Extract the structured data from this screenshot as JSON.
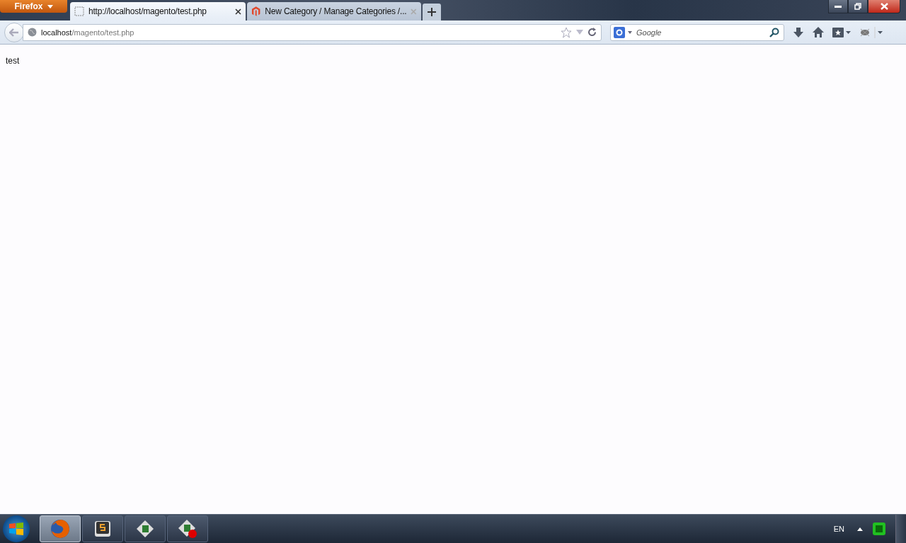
{
  "menu_button": {
    "label": "Firefox"
  },
  "tabs": [
    {
      "title": "http://localhost/magento/test.php",
      "selected": true,
      "kind": "blank"
    },
    {
      "title": "New Category / Manage Categories /...",
      "selected": false,
      "kind": "magento"
    }
  ],
  "address_bar": {
    "host": "localhost",
    "path": "/magento/test.php"
  },
  "search": {
    "placeholder": "Google"
  },
  "page": {
    "text": "test"
  },
  "taskbar": {
    "items": [
      {
        "kind": "firefox",
        "selected": true
      },
      {
        "kind": "sublime",
        "selected": false
      },
      {
        "kind": "sheet",
        "selected": false
      },
      {
        "kind": "sheet-record",
        "selected": false
      }
    ],
    "language": "EN"
  }
}
